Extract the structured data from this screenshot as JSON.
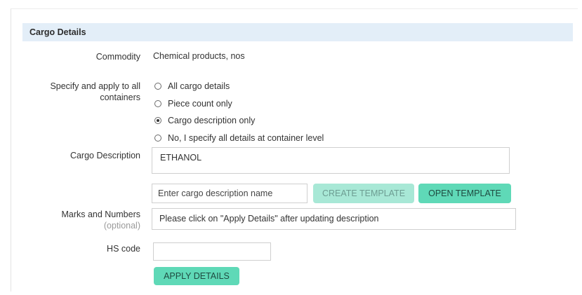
{
  "section": {
    "title": "Cargo Details"
  },
  "commodity": {
    "label": "Commodity",
    "value": "Chemical products, nos"
  },
  "apply_scope": {
    "label_line1": "Specify and apply to all",
    "label_line2": "containers",
    "options": [
      {
        "label": "All cargo details",
        "checked": false
      },
      {
        "label": "Piece count only",
        "checked": false
      },
      {
        "label": "Cargo description only",
        "checked": true
      },
      {
        "label": "No, I specify all details at container level",
        "checked": false
      }
    ]
  },
  "cargo_description": {
    "label": "Cargo Description",
    "value": "ETHANOL",
    "template_name_placeholder": "Enter cargo description name",
    "create_template_label": "CREATE TEMPLATE",
    "open_template_label": "OPEN TEMPLATE"
  },
  "marks": {
    "label": "Marks and Numbers",
    "optional": "(optional)",
    "value": "Please click on \"Apply Details\" after updating description"
  },
  "hs_code": {
    "label": "HS code",
    "value": ""
  },
  "apply_button": {
    "label": "APPLY DETAILS"
  }
}
